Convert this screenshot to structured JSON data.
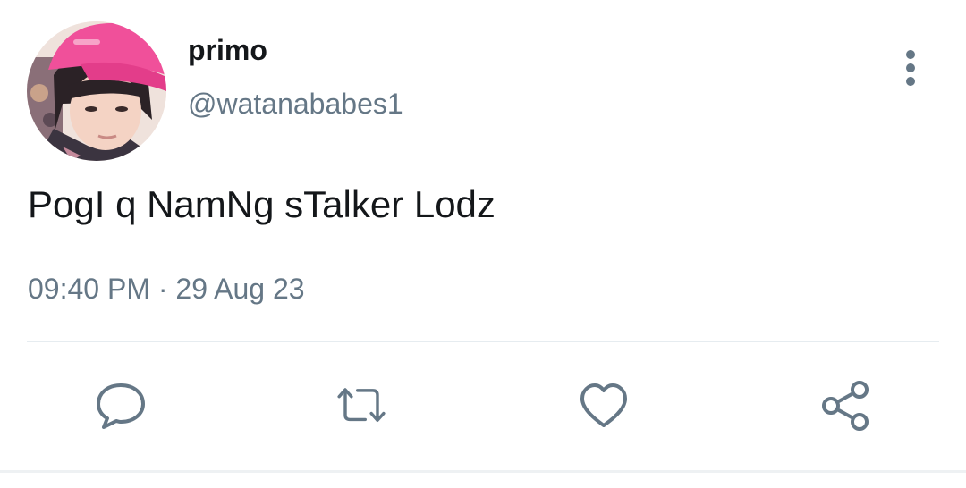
{
  "user": {
    "display_name": "primo",
    "handle": "@watanababes1"
  },
  "tweet": {
    "text": "PogI q NamNg sTalker Lodz",
    "time": "09:40 PM",
    "separator": "·",
    "date": "29 Aug 23"
  },
  "actions": {
    "reply_icon": "speech-bubble-icon",
    "retweet_icon": "retweet-arrows-icon",
    "like_icon": "heart-icon",
    "share_icon": "share-nodes-icon"
  },
  "colors": {
    "text_primary": "#14171a",
    "text_secondary": "#657786",
    "divider": "#e6ecf0",
    "avatar_cap": "#f0509a"
  }
}
